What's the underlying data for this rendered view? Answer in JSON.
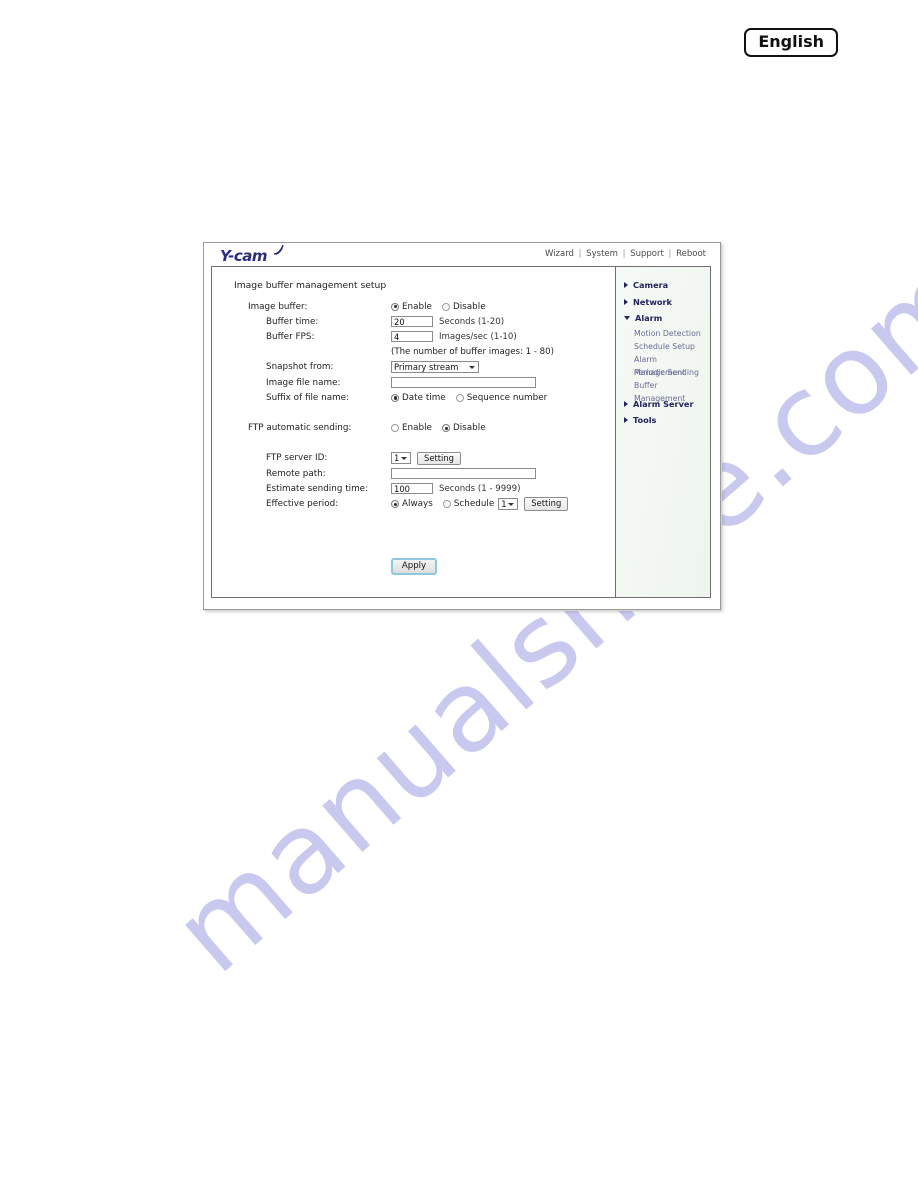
{
  "language_badge": {
    "label": "English"
  },
  "watermark": {
    "text": "manualshive.com"
  },
  "app": {
    "logo_text": "Y-cam",
    "logo_icon": "wifi-swoosh-icon",
    "top_links": [
      {
        "label": "Wizard"
      },
      {
        "label": "System"
      },
      {
        "label": "Support"
      },
      {
        "label": "Reboot"
      }
    ],
    "link_separator": "|"
  },
  "page": {
    "title": "Image buffer management setup",
    "apply_label": "Apply"
  },
  "form": {
    "image_buffer": {
      "label": "Image buffer:",
      "enable_label": "Enable",
      "disable_label": "Disable",
      "selected": "Enable"
    },
    "buffer_time": {
      "label": "Buffer time:",
      "value": "20",
      "hint": "Seconds (1-20)"
    },
    "buffer_fps": {
      "label": "Buffer FPS:",
      "value": "4",
      "hint": "Images/sec (1-10)"
    },
    "buffer_images_note": "(The number of buffer images: 1 - 80)",
    "snapshot_from": {
      "label": "Snapshot from:",
      "value": "Primary stream"
    },
    "image_file_name": {
      "label": "Image file name:",
      "value": "",
      "placeholder": ""
    },
    "suffix_of_file_name": {
      "label": "Suffix of file name:",
      "date_time_label": "Date time",
      "sequence_number_label": "Sequence number",
      "selected": "Date time"
    },
    "ftp_automatic_sending": {
      "label": "FTP automatic sending:",
      "enable_label": "Enable",
      "disable_label": "Disable",
      "selected": "Disable"
    },
    "ftp_server_id": {
      "label": "FTP server ID:",
      "value": "1",
      "setting_label": "Setting"
    },
    "remote_path": {
      "label": "Remote path:",
      "value": "",
      "placeholder": ""
    },
    "estimate_sending_time": {
      "label": "Estimate sending time:",
      "value": "100",
      "hint": "Seconds (1 - 9999)"
    },
    "effective_period": {
      "label": "Effective period:",
      "always_label": "Always",
      "schedule_label": "Schedule",
      "schedule_value": "1",
      "setting_label": "Setting",
      "selected": "Always"
    }
  },
  "sidebar": {
    "items": [
      {
        "label": "Camera",
        "type": "top",
        "expanded": false
      },
      {
        "label": "Network",
        "type": "top",
        "expanded": false
      },
      {
        "label": "Alarm",
        "type": "top",
        "expanded": true
      },
      {
        "label": "Motion Detection",
        "type": "sub"
      },
      {
        "label": "Schedule Setup",
        "type": "sub"
      },
      {
        "label": "Alarm Management",
        "type": "sub"
      },
      {
        "label": "Periodic Sending",
        "type": "sub"
      },
      {
        "label": "Buffer Management",
        "type": "sub"
      },
      {
        "label": "Alarm Server",
        "type": "top",
        "expanded": false
      },
      {
        "label": "Tools",
        "type": "top",
        "expanded": false
      }
    ]
  },
  "colors": {
    "logo": "#2a2f7a",
    "sidebar_top": "#23235c",
    "sidebar_sub": "#6b6b96",
    "watermark": "#c9c9ef",
    "apply_focus_border": "#8fc7dd"
  }
}
